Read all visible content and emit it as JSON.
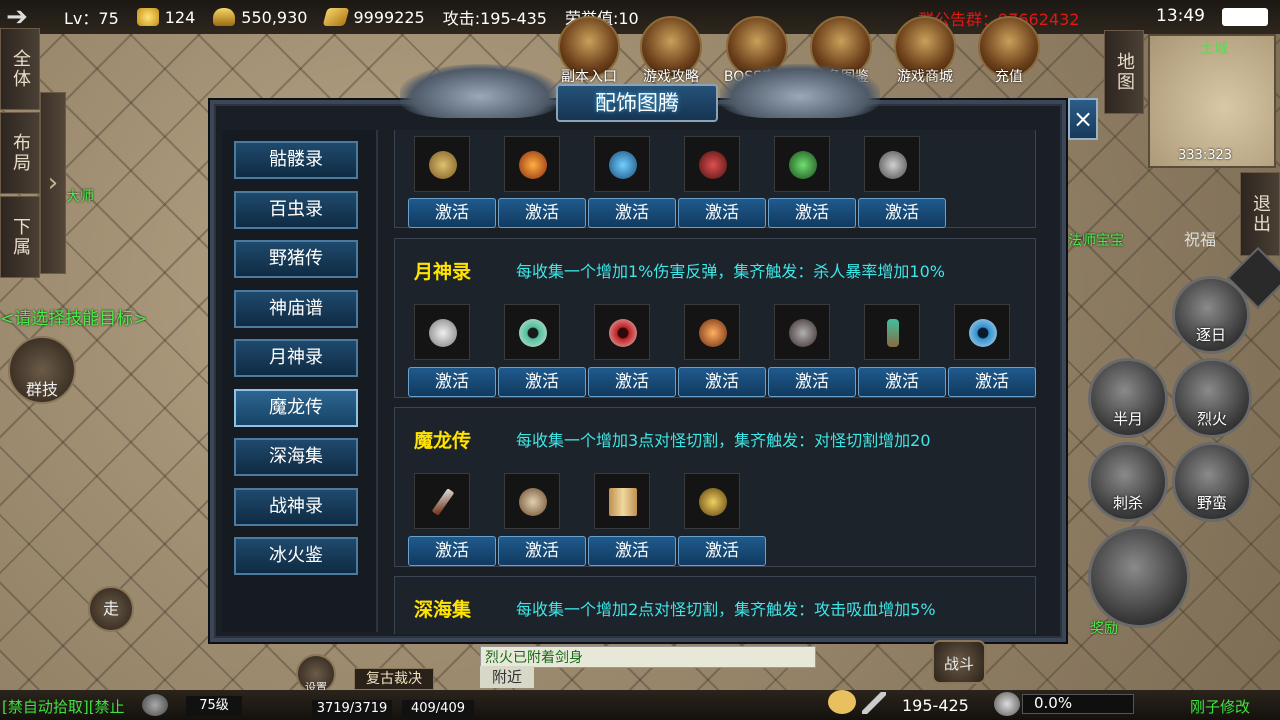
{
  "topbar": {
    "level": "Lv：75",
    "gold": "124",
    "ingots": "550,930",
    "yuanbao": "9999225",
    "attack": "攻击:195-435",
    "honor": "荣誉值:10",
    "notice": "群公告群：97662432",
    "clock": "13:49"
  },
  "features": [
    "副本入口",
    "游戏攻略",
    "BOSS查询",
    "装备图鉴",
    "游戏商城",
    "充值"
  ],
  "left_tabs": [
    "全体",
    "布局",
    "下属"
  ],
  "left_labels": {
    "mage": "大师",
    "target_hint": "<请选择技能目标>",
    "group_skill": "群技",
    "walk": "走"
  },
  "right": {
    "map_btn": "地图",
    "map_name": "土城",
    "map_coords": "333:323",
    "exit_btn": "退出",
    "blessing": "祝福",
    "npc_label": "法师宝宝",
    "reward_label": "奖励"
  },
  "skills": [
    "逐日",
    "半月",
    "烈火",
    "刺杀",
    "野蛮"
  ],
  "panel": {
    "title": "配饰图腾",
    "close": "×",
    "categories": [
      "骷髅录",
      "百虫录",
      "野猪传",
      "神庙谱",
      "月神录",
      "魔龙传",
      "深海集",
      "战神录",
      "冰火鉴"
    ],
    "active_category": "魔龙传",
    "activate_label": "激活",
    "sections": [
      {
        "title": "",
        "desc": "",
        "items": [
          "compass-amulet",
          "fire-lantern",
          "blue-orb",
          "red-shield",
          "green-gem",
          "horned-helm"
        ]
      },
      {
        "title": "月神录",
        "desc": "每收集一个增加1%伤害反弹，集齐触发：杀人暴率增加10%",
        "items": [
          "hand-mirror",
          "green-eye",
          "red-eye",
          "spiked-orb",
          "dragon-ring",
          "jade-sword",
          "blue-eye"
        ]
      },
      {
        "title": "魔龙传",
        "desc": "每收集一个增加3点对怪切割，集齐触发：对怪切割增加20",
        "items": [
          "dagger",
          "bone-charm",
          "open-book",
          "gold-pendant"
        ]
      },
      {
        "title": "深海集",
        "desc": "每收集一个增加2点对怪切割，集齐触发：攻击吸血增加5%"
      }
    ]
  },
  "bottom": {
    "left_text": "[禁自动拾取][禁止",
    "level": "75级",
    "hp": "3719/3719",
    "mp": "409/409",
    "chat_hint": "附近",
    "chat_text": "烈火已附着剑身",
    "ancient_btn": "复古裁决",
    "settings": "设置",
    "coords": "195-425",
    "exp": "0.0%",
    "exp_fraction": 0.0,
    "battle": "战斗",
    "right_text": "刚子修改"
  },
  "colors": {
    "section_title": "#ffe400",
    "section_desc": "#3fe6e6",
    "activate_btn": "#1f5a8d",
    "notice": "#e01818"
  }
}
